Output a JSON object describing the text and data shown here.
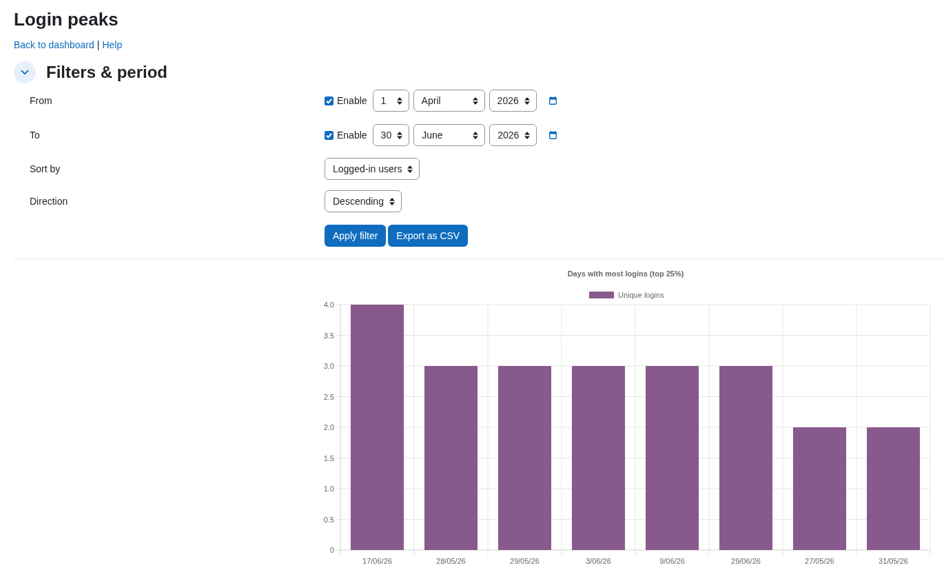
{
  "page": {
    "title": "Login peaks"
  },
  "links": [
    {
      "label": "Back to dashboard"
    },
    {
      "label": "Help"
    }
  ],
  "link_separator": "|",
  "section": {
    "title": "Filters & period",
    "expanded": true
  },
  "date_filters": [
    {
      "label": "From",
      "enabled": true,
      "enable_label": "Enable",
      "day": "1",
      "month": "April",
      "year": "2026"
    },
    {
      "label": "To",
      "enabled": true,
      "enable_label": "Enable",
      "day": "30",
      "month": "June",
      "year": "2026"
    }
  ],
  "selects": [
    {
      "label": "Sort by",
      "value": "Logged-in users"
    },
    {
      "label": "Direction",
      "value": "Descending"
    }
  ],
  "buttons": [
    "Apply filter",
    "Export as CSV"
  ],
  "chart_data": {
    "type": "bar",
    "title": "Days with most logins (top 25%)",
    "categories": [
      "17/06/26",
      "28/05/26",
      "29/05/26",
      "3/06/26",
      "9/06/26",
      "29/06/26",
      "27/05/26",
      "31/05/26"
    ],
    "series": [
      {
        "name": "Unique logins",
        "color": "#88598c",
        "values": [
          4,
          3,
          3,
          3,
          3,
          3,
          2,
          2
        ]
      }
    ],
    "ylim": [
      0,
      4
    ],
    "yticks": [
      {
        "value": 0,
        "label": "0"
      },
      {
        "value": 0.5,
        "label": "0.5"
      },
      {
        "value": 1,
        "label": "1.0"
      },
      {
        "value": 1.5,
        "label": "1.5"
      },
      {
        "value": 2,
        "label": "2.0"
      },
      {
        "value": 2.5,
        "label": "2.5"
      },
      {
        "value": 3,
        "label": "3.0"
      },
      {
        "value": 3.5,
        "label": "3.5"
      },
      {
        "value": 4,
        "label": "4.0"
      }
    ],
    "grid": true
  }
}
